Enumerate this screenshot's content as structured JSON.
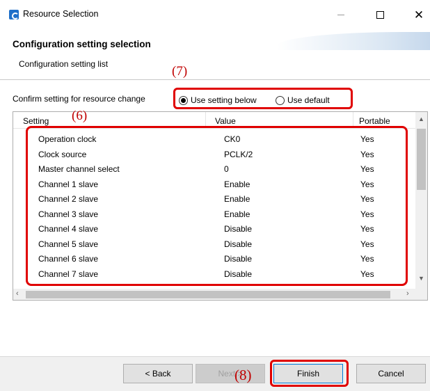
{
  "window": {
    "title": "Resource Selection"
  },
  "header": {
    "title": "Configuration setting selection",
    "subtitle": "Configuration setting list"
  },
  "annotations": {
    "seven": "(7)",
    "six": "(6)",
    "eight": "(8)"
  },
  "confirm": {
    "label": "Confirm setting for resource change",
    "options": [
      {
        "label": "Use setting below",
        "checked": true
      },
      {
        "label": "Use default",
        "checked": false
      }
    ]
  },
  "table": {
    "columns": [
      "Setting",
      "Value",
      "Portable"
    ],
    "rows": [
      {
        "setting": "Operation clock",
        "value": "CK0",
        "portable": "Yes"
      },
      {
        "setting": "Clock source",
        "value": "PCLK/2",
        "portable": "Yes"
      },
      {
        "setting": "Master channel select",
        "value": "0",
        "portable": "Yes"
      },
      {
        "setting": "Channel 1 slave",
        "value": "Enable",
        "portable": "Yes"
      },
      {
        "setting": "Channel 2 slave",
        "value": "Enable",
        "portable": "Yes"
      },
      {
        "setting": "Channel 3 slave",
        "value": "Enable",
        "portable": "Yes"
      },
      {
        "setting": "Channel 4 slave",
        "value": "Disable",
        "portable": "Yes"
      },
      {
        "setting": "Channel 5 slave",
        "value": "Disable",
        "portable": "Yes"
      },
      {
        "setting": "Channel 6 slave",
        "value": "Disable",
        "portable": "Yes"
      },
      {
        "setting": "Channel 7 slave",
        "value": "Disable",
        "portable": "Yes"
      }
    ]
  },
  "buttons": {
    "back": "< Back",
    "next": "Next >",
    "finish": "Finish",
    "cancel": "Cancel"
  },
  "colors": {
    "highlight": "#e00000",
    "accent": "#0078d7"
  }
}
